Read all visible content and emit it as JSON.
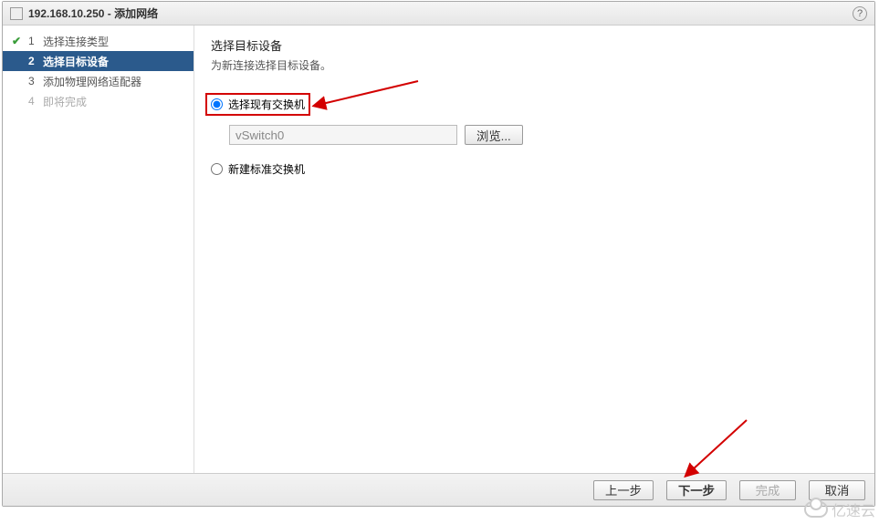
{
  "titlebar": {
    "host": "192.168.10.250",
    "separator": " - ",
    "title": "添加网络"
  },
  "steps": [
    {
      "num": "1",
      "label": "选择连接类型",
      "state": "done"
    },
    {
      "num": "2",
      "label": "选择目标设备",
      "state": "active"
    },
    {
      "num": "3",
      "label": "添加物理网络适配器",
      "state": "normal"
    },
    {
      "num": "4",
      "label": "即将完成",
      "state": "pending"
    }
  ],
  "content": {
    "heading": "选择目标设备",
    "subheading": "为新连接选择目标设备。",
    "option_existing": "选择现有交换机",
    "switch_value": "vSwitch0",
    "browse_label": "浏览...",
    "option_new": "新建标准交换机"
  },
  "footer": {
    "back": "上一步",
    "next": "下一步",
    "finish": "完成",
    "cancel": "取消"
  },
  "watermark": "亿速云"
}
